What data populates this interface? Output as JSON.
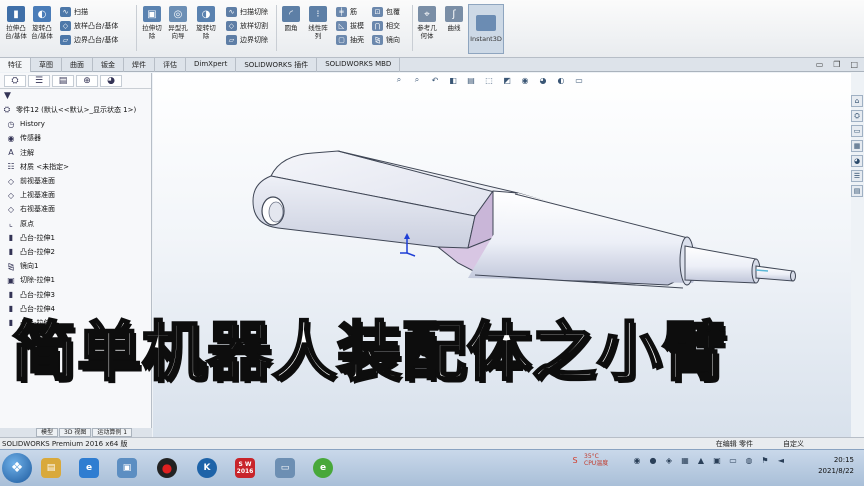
{
  "ribbon": {
    "big_buttons": [
      {
        "label": "拉伸凸\n台/基体",
        "icon": "extrude-boss-icon",
        "color": "#3f6fa8"
      },
      {
        "label": "旋转凸\n台/基体",
        "icon": "revolve-boss-icon",
        "color": "#4a7cb8"
      },
      {
        "label": "拉伸切\n除",
        "icon": "extrude-cut-icon",
        "color": "#5a82b0"
      },
      {
        "label": "异型孔\n向导",
        "icon": "hole-wizard-icon",
        "color": "#6c8fb5"
      },
      {
        "label": "旋转切\n除",
        "icon": "revolve-cut-icon",
        "color": "#5a82b0"
      },
      {
        "label": "圆角",
        "icon": "fillet-icon",
        "color": "#5d7fa6"
      },
      {
        "label": "线性阵\n列",
        "icon": "linear-pattern-icon",
        "color": "#5d7fa6"
      },
      {
        "label": "参考几\n何体",
        "icon": "reference-geometry-icon",
        "color": "#7a8ea6"
      },
      {
        "label": "曲线",
        "icon": "curves-icon",
        "color": "#7a8ea6"
      }
    ],
    "small_col_1": [
      {
        "label": "扫描",
        "icon": "sweep-icon"
      },
      {
        "label": "放样凸台/基体",
        "icon": "loft-icon"
      },
      {
        "label": "边界凸台/基体",
        "icon": "boundary-boss-icon"
      }
    ],
    "small_col_2": [
      {
        "label": "扫描切除",
        "icon": "swept-cut-icon"
      },
      {
        "label": "放样切割",
        "icon": "lofted-cut-icon"
      },
      {
        "label": "边界切除",
        "icon": "boundary-cut-icon"
      }
    ],
    "small_col_3": [
      {
        "label": "筋",
        "icon": "rib-icon"
      },
      {
        "label": "拔模",
        "icon": "draft-icon"
      },
      {
        "label": "抽壳",
        "icon": "shell-icon"
      }
    ],
    "small_col_4": [
      {
        "label": "包覆",
        "icon": "wrap-icon"
      },
      {
        "label": "相交",
        "icon": "intersect-icon"
      },
      {
        "label": "镜向",
        "icon": "mirror-icon"
      }
    ],
    "instant3d_label": "Instant3D"
  },
  "command_tabs": [
    "特征",
    "草图",
    "曲面",
    "钣金",
    "焊件",
    "评估",
    "DimXpert",
    "SOLIDWORKS 插件",
    "SOLIDWORKS MBD"
  ],
  "feature_tree": {
    "root": "零件12 (默认<<默认>_显示状态 1>)",
    "items": [
      {
        "label": "History",
        "icon": "history-icon"
      },
      {
        "label": "传感器",
        "icon": "sensor-icon"
      },
      {
        "label": "注解",
        "icon": "annotation-icon"
      },
      {
        "label": "材质 <未指定>",
        "icon": "material-icon"
      },
      {
        "label": "前视基准面",
        "icon": "plane-icon"
      },
      {
        "label": "上视基准面",
        "icon": "plane-icon"
      },
      {
        "label": "右视基准面",
        "icon": "plane-icon"
      },
      {
        "label": "原点",
        "icon": "origin-icon"
      },
      {
        "label": "凸台-拉伸1",
        "icon": "boss-extrude-icon"
      },
      {
        "label": "凸台-拉伸2",
        "icon": "boss-extrude-icon"
      },
      {
        "label": "镜向1",
        "icon": "mirror-feature-icon"
      },
      {
        "label": "切除-拉伸1",
        "icon": "cut-extrude-icon"
      },
      {
        "label": "凸台-拉伸3",
        "icon": "boss-extrude-icon"
      },
      {
        "label": "凸台-拉伸4",
        "icon": "boss-extrude-icon"
      },
      {
        "label": "凸台-拉伸5",
        "icon": "boss-extrude-icon"
      }
    ]
  },
  "bottom_tabs": [
    "模型",
    "3D 视图",
    "运动算例 1"
  ],
  "caption": "简单机器人装配体之小臂",
  "status_bar": {
    "app": "SOLIDWORKS Premium 2016 x64 版",
    "editing": "在编辑 零件",
    "custom": "自定义"
  },
  "taskbar": {
    "sw_label": "S W 2016",
    "temperature": "35°C",
    "cpu": "CPU温度",
    "time": "20:15",
    "date": "2021/8/22"
  },
  "colors": {
    "part_face": "#e9ecf5",
    "part_shade": "#c3c9dd",
    "part_shadow": "#9aa1b8",
    "end_face": "#d7bfe0",
    "axis_blue": "#1f3fd6"
  }
}
